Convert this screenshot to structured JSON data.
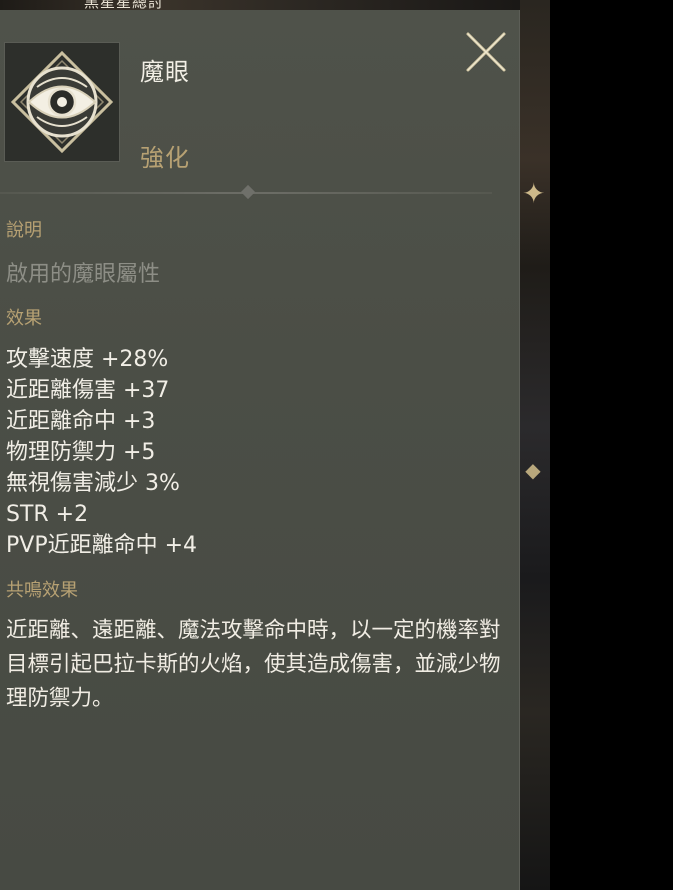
{
  "top_hint": "黑星星總討",
  "item": {
    "name": "魔眼",
    "type": "強化",
    "icon": "eye-icon"
  },
  "close_icon": "close-icon",
  "description": {
    "title": "說明",
    "text": "啟用的魔眼屬性"
  },
  "effects": {
    "title": "效果",
    "items": [
      "攻擊速度 +28%",
      "近距離傷害 +37",
      "近距離命中 +3",
      "物理防禦力 +5",
      "無視傷害減少 3%",
      "STR +2",
      "PVP近距離命中 +4"
    ]
  },
  "resonance": {
    "title": "共鳴效果",
    "text": "近距離、遠距離、魔法攻擊命中時，以一定的機率對目標引起巴拉卡斯的火焰，使其造成傷害，並減少物理防禦力。"
  },
  "colors": {
    "panel": "#4c4f47",
    "accent": "#b7a173",
    "text": "#f1eee6",
    "muted": "#8d8e86"
  }
}
